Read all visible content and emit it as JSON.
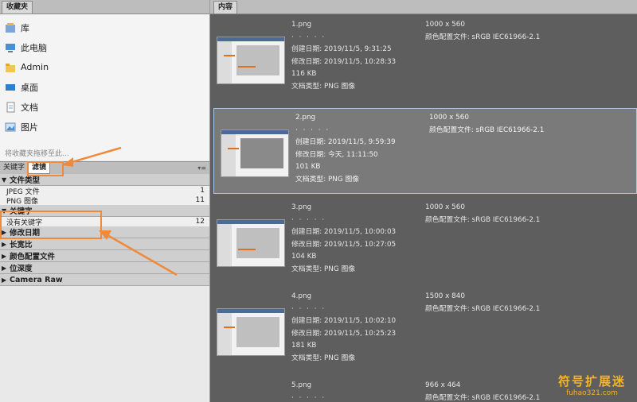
{
  "favorites_panel": {
    "tab": "收藏夹",
    "items": [
      {
        "label": "库",
        "icon": "library-icon"
      },
      {
        "label": "此电脑",
        "icon": "computer-icon"
      },
      {
        "label": "Admin",
        "icon": "folder-icon"
      },
      {
        "label": "桌面",
        "icon": "desktop-icon"
      },
      {
        "label": "文档",
        "icon": "document-icon"
      },
      {
        "label": "图片",
        "icon": "pictures-icon"
      }
    ],
    "hint": "将收藏夹拖移至此..."
  },
  "filter_panel": {
    "tabs": [
      "关键字",
      "滤镜"
    ],
    "menu_icon": "panel-menu-icon",
    "categories": [
      {
        "label": "文件类型",
        "expanded": true,
        "rows": [
          {
            "label": "JPEG 文件",
            "count": "1"
          },
          {
            "label": "PNG 图像",
            "count": "11"
          }
        ]
      },
      {
        "label": "关键字",
        "expanded": true,
        "rows": [
          {
            "label": "没有关键字",
            "count": "12"
          }
        ]
      },
      {
        "label": "修改日期",
        "expanded": false,
        "rows": []
      },
      {
        "label": "长宽比",
        "expanded": false,
        "rows": []
      },
      {
        "label": "颜色配置文件",
        "expanded": false,
        "rows": []
      },
      {
        "label": "位深度",
        "expanded": false,
        "rows": []
      },
      {
        "label": "Camera Raw",
        "expanded": false,
        "rows": []
      }
    ]
  },
  "content_panel": {
    "tab": "内容",
    "items": [
      {
        "name": "1.png",
        "dots": "· · · · ·",
        "created": "创建日期: 2019/11/5, 9:31:25",
        "modified": "修改日期: 2019/11/5, 10:28:33",
        "size": "116 KB",
        "type": "文档类型: PNG 图像",
        "dimensions": "1000 x 560",
        "profile": "颜色配置文件: sRGB IEC61966-2.1",
        "selected": false
      },
      {
        "name": "2.png",
        "dots": "· · · · ·",
        "created": "创建日期: 2019/11/5, 9:59:39",
        "modified": "修改日期: 今天, 11:11:50",
        "size": "101 KB",
        "type": "文档类型: PNG 图像",
        "dimensions": "1000 x 560",
        "profile": "颜色配置文件: sRGB IEC61966-2.1",
        "selected": true
      },
      {
        "name": "3.png",
        "dots": "· · · · ·",
        "created": "创建日期: 2019/11/5, 10:00:03",
        "modified": "修改日期: 2019/11/5, 10:27:05",
        "size": "104 KB",
        "type": "文档类型: PNG 图像",
        "dimensions": "1000 x 560",
        "profile": "颜色配置文件: sRGB IEC61966-2.1",
        "selected": false
      },
      {
        "name": "4.png",
        "dots": "· · · · ·",
        "created": "创建日期: 2019/11/5, 10:02:10",
        "modified": "修改日期: 2019/11/5, 10:25:23",
        "size": "181 KB",
        "type": "文档类型: PNG 图像",
        "dimensions": "1500 x 840",
        "profile": "颜色配置文件: sRGB IEC61966-2.1",
        "selected": false
      },
      {
        "name": "5.png",
        "dots": "· · · · ·",
        "created": "",
        "modified": "",
        "size": "",
        "type": "",
        "dimensions": "966 x 464",
        "profile": "颜色配置文件: sRGB IEC61966-2.1",
        "selected": false
      }
    ]
  },
  "watermark": {
    "line1": "符号扩展迷",
    "line2": "fuhao321.com"
  },
  "colors": {
    "annotation": "#f08a3a",
    "selection_border": "#a9c6e8",
    "watermark": "#f3b32b"
  }
}
